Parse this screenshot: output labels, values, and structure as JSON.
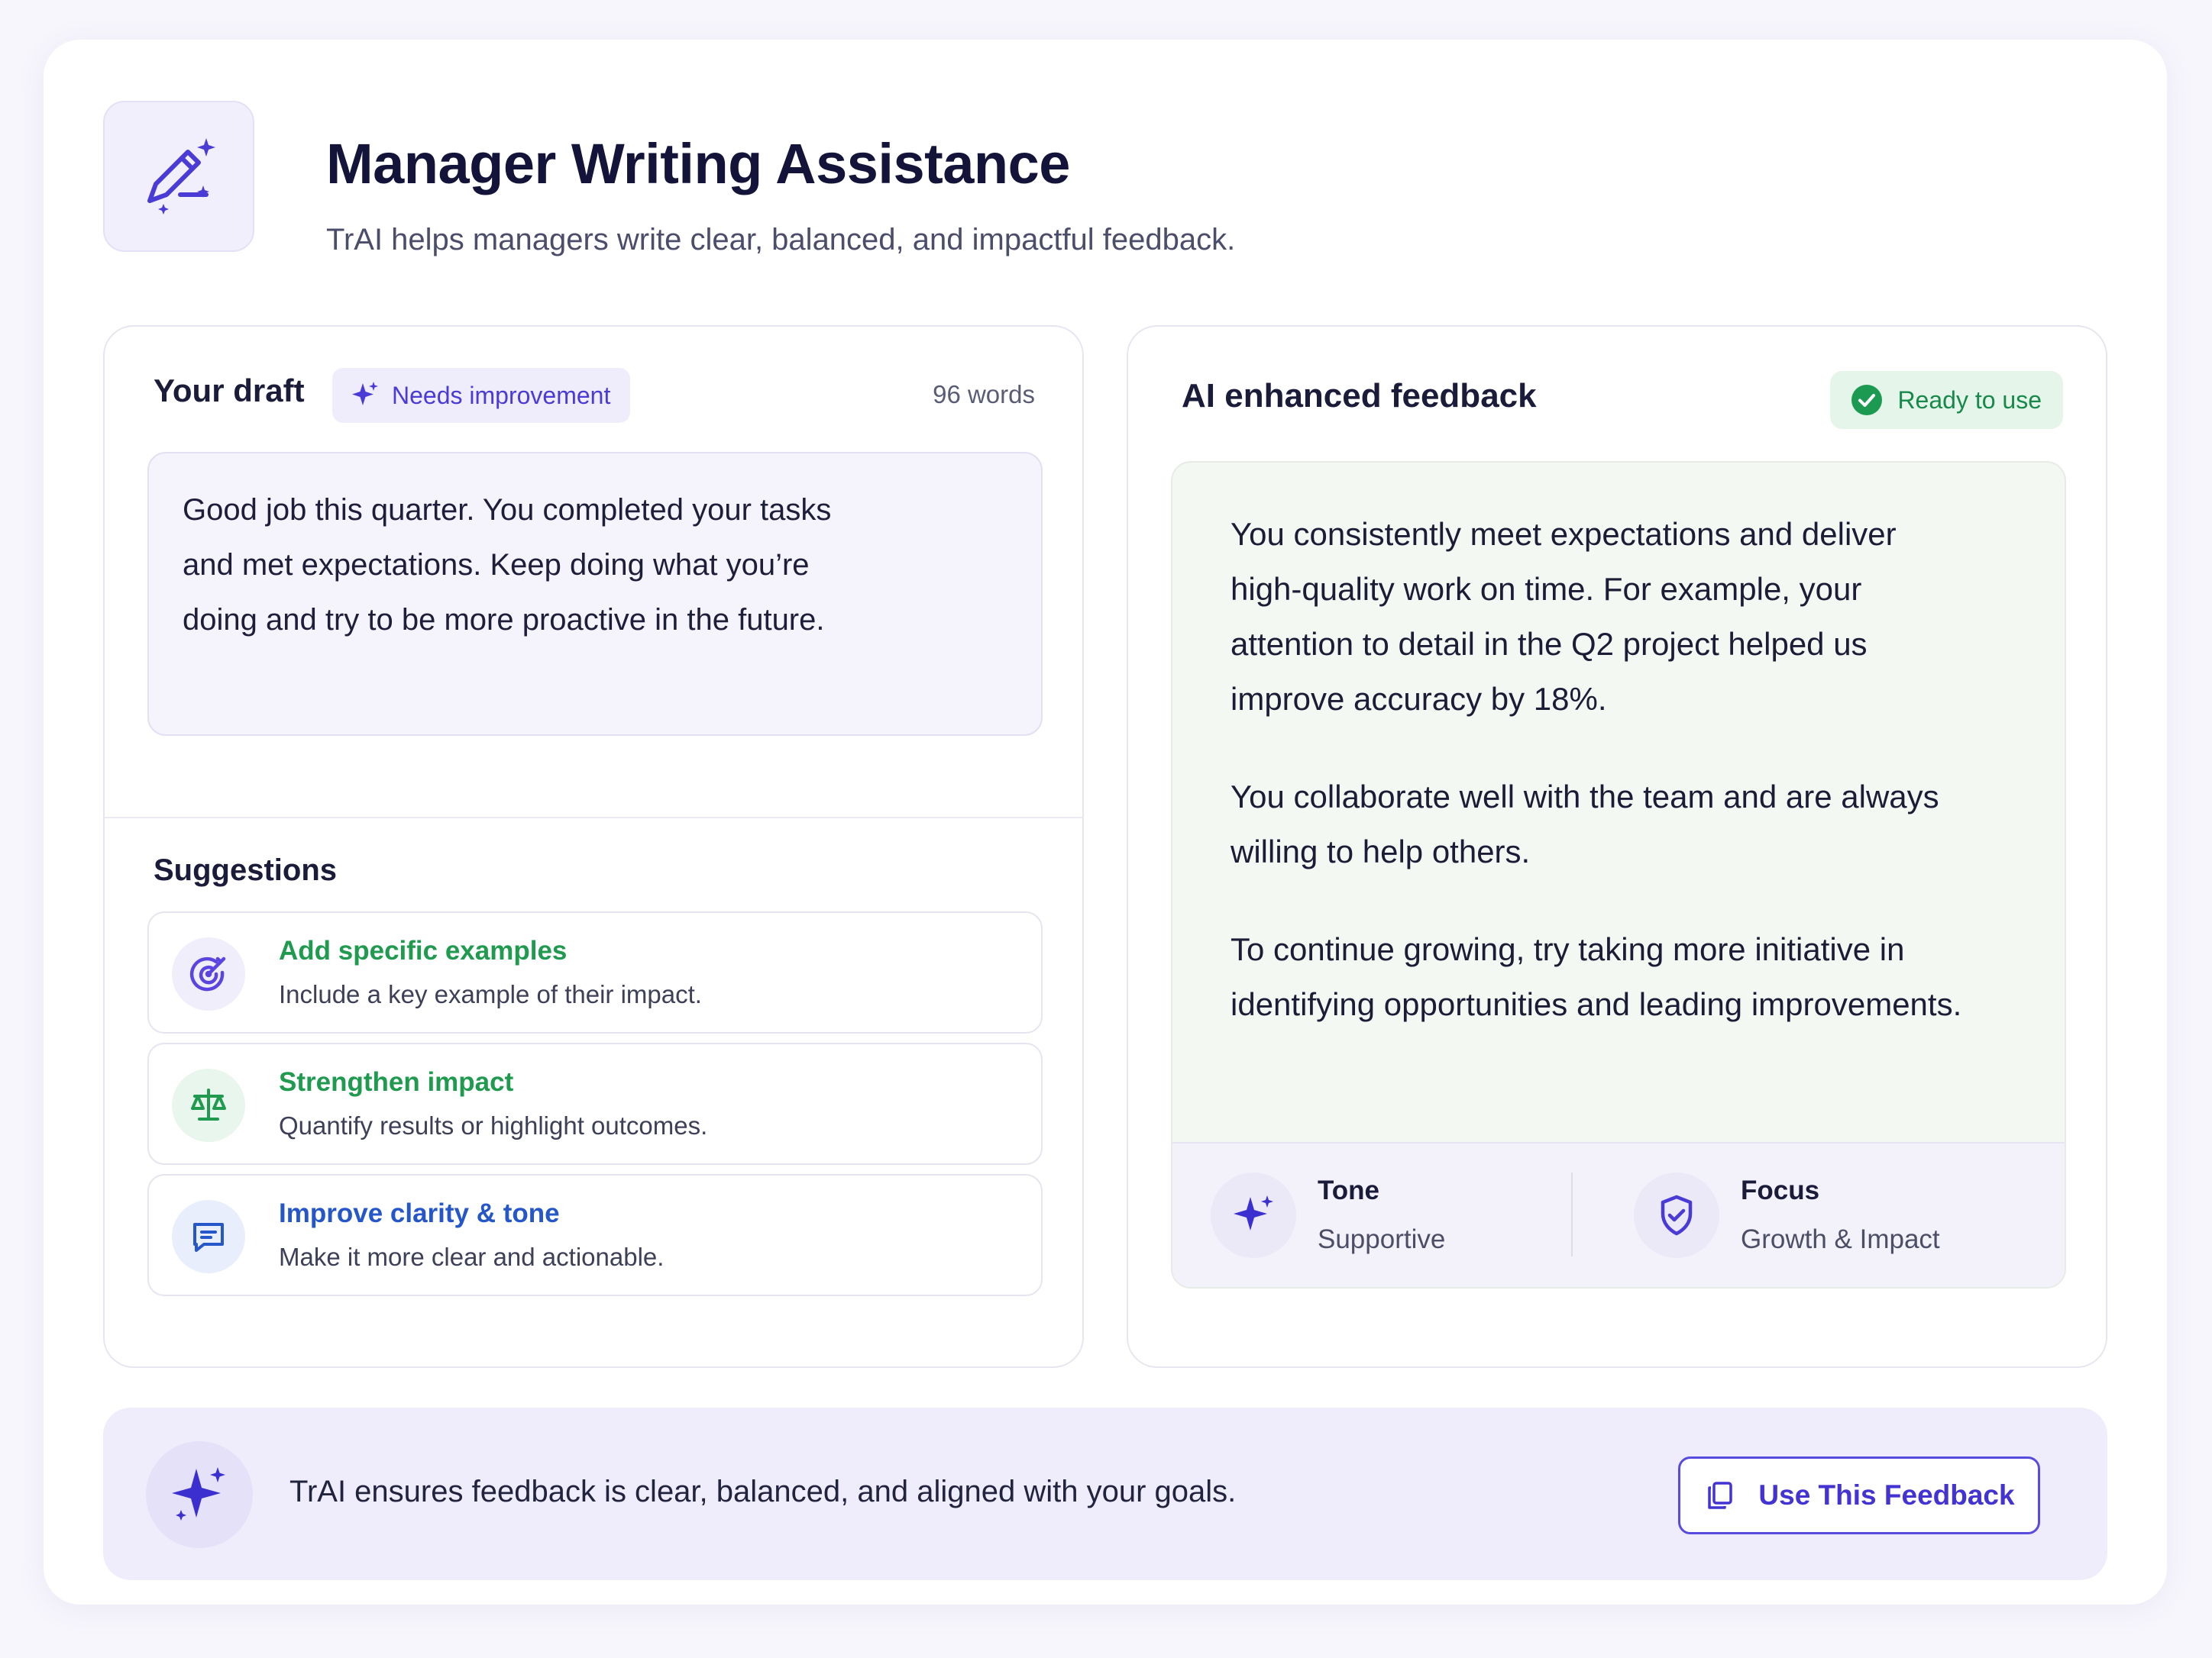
{
  "header": {
    "title": "Manager Writing Assistance",
    "subtitle": "TrAI helps managers write clear, balanced, and impactful feedback.",
    "logo_icon": "magic-pen-icon"
  },
  "draft": {
    "title": "Your draft",
    "badge": "Needs improvement",
    "word_count": "96 words",
    "text": "Good job this quarter. You completed your tasks and met expectations. Keep doing what you’re doing and try to be more proactive in the future."
  },
  "suggestions": {
    "title": "Suggestions",
    "items": [
      {
        "title": "Add specific examples",
        "desc": "Include a key example of their impact.",
        "icon": "target-icon",
        "color": "#1f9a4f"
      },
      {
        "title": "Strengthen impact",
        "desc": "Quantify results or highlight outcomes.",
        "icon": "scale-icon",
        "color": "#1f9a4f"
      },
      {
        "title": "Improve clarity & tone",
        "desc": "Make it more clear and actionable.",
        "icon": "message-icon",
        "color": "#2557c9"
      }
    ]
  },
  "ai": {
    "title": "AI enhanced feedback",
    "badge": "Ready to use",
    "paragraphs": [
      "You consistently meet expectations and deliver high-quality work on time. For example, your attention to detail in the Q2 project helped us improve accuracy by 18%.",
      "You collaborate well with the team and are always willing to help others.",
      "To continue growing, try taking more initiative in identifying opportunities and leading improvements."
    ],
    "meta": [
      {
        "label": "Tone",
        "value": "Supportive",
        "icon": "sparkle-icon"
      },
      {
        "label": "Focus",
        "value": "Growth & Impact",
        "icon": "shield-check-icon"
      }
    ]
  },
  "footer": {
    "text": "TrAI ensures feedback is clear, balanced, and aligned with your goals.",
    "button": "Use This Feedback",
    "button_icon": "copy-icon"
  },
  "colors": {
    "accent": "#4a3bd6",
    "success": "#17894a",
    "link_blue": "#2557c9"
  }
}
